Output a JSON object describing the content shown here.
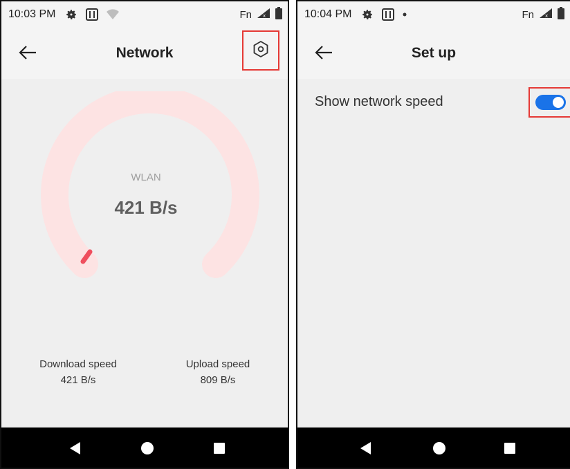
{
  "screen1": {
    "status": {
      "time": "10:03 PM",
      "fn": "Fn"
    },
    "title": "Network",
    "gauge": {
      "label": "WLAN",
      "value": "421 B/s"
    },
    "download": {
      "label": "Download speed",
      "value": "421 B/s"
    },
    "upload": {
      "label": "Upload speed",
      "value": "809 B/s"
    }
  },
  "screen2": {
    "status": {
      "time": "10:04 PM",
      "fn": "Fn"
    },
    "title": "Set up",
    "setting": {
      "label": "Show network speed",
      "enabled": true
    }
  },
  "colors": {
    "accent": "#1a73e8",
    "gauge_track": "#fde3e3",
    "gauge_needle": "#ef4f5e",
    "highlight": "#e53935"
  },
  "icons": [
    "gear-icon",
    "sim-icon",
    "wifi-icon",
    "signal-icon",
    "battery-icon",
    "back-arrow-icon",
    "settings-hexagon-icon",
    "nav-back-icon",
    "nav-home-icon",
    "nav-recents-icon"
  ]
}
